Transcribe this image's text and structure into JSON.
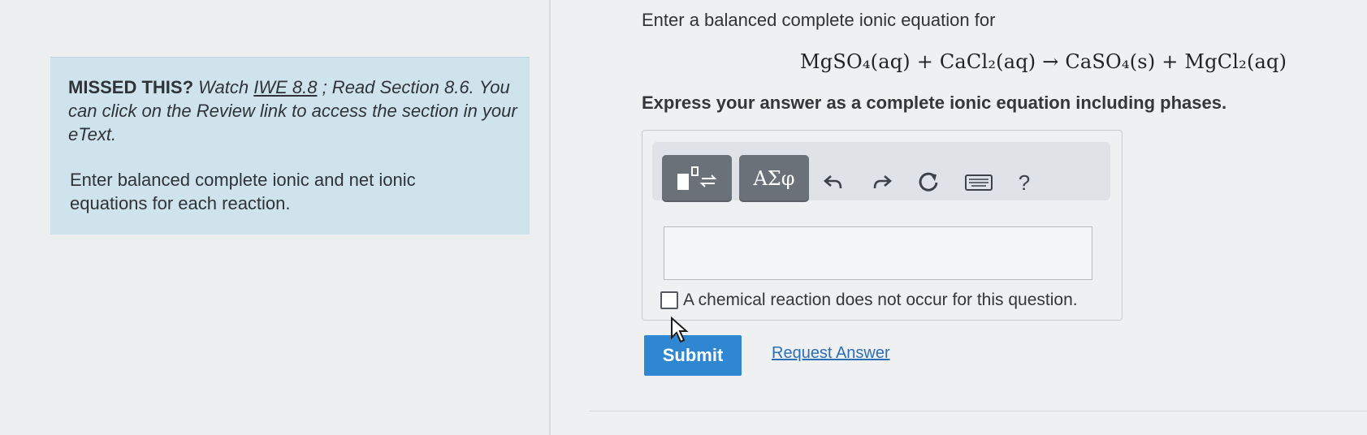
{
  "hint": {
    "missed_label": "MISSED THIS?",
    "watch_text": " Watch ",
    "iwe_link": "IWE 8.8",
    "read_text": "; Read Section 8.6.",
    "review_text": "You can click on the Review link to access the section in your eText.",
    "instruction": "Enter balanced complete ionic and net ionic equations for each reaction."
  },
  "question": {
    "prompt": "Enter a balanced complete ionic equation for",
    "equation": "MgSO₄(aq) + CaCl₂(aq) → CaSO₄(s) + MgCl₂(aq)",
    "instruction": "Express your answer as a complete ionic equation including phases."
  },
  "toolbar": {
    "symbols_label": "ΑΣφ",
    "help_label": "?"
  },
  "icons": {
    "templates": "templates-icon",
    "undo": "undo-icon",
    "redo": "redo-icon",
    "reset": "reset-icon",
    "keyboard": "keyboard-icon",
    "help": "help-icon"
  },
  "answer": {
    "value": "",
    "no_reaction_label": "A chemical reaction does not occur for this question."
  },
  "actions": {
    "submit_label": "Submit",
    "request_label": "Request Answer"
  },
  "colors": {
    "hint_bg": "#cfe3ec",
    "submit_bg": "#2f86d1",
    "link": "#2d6fb5"
  }
}
